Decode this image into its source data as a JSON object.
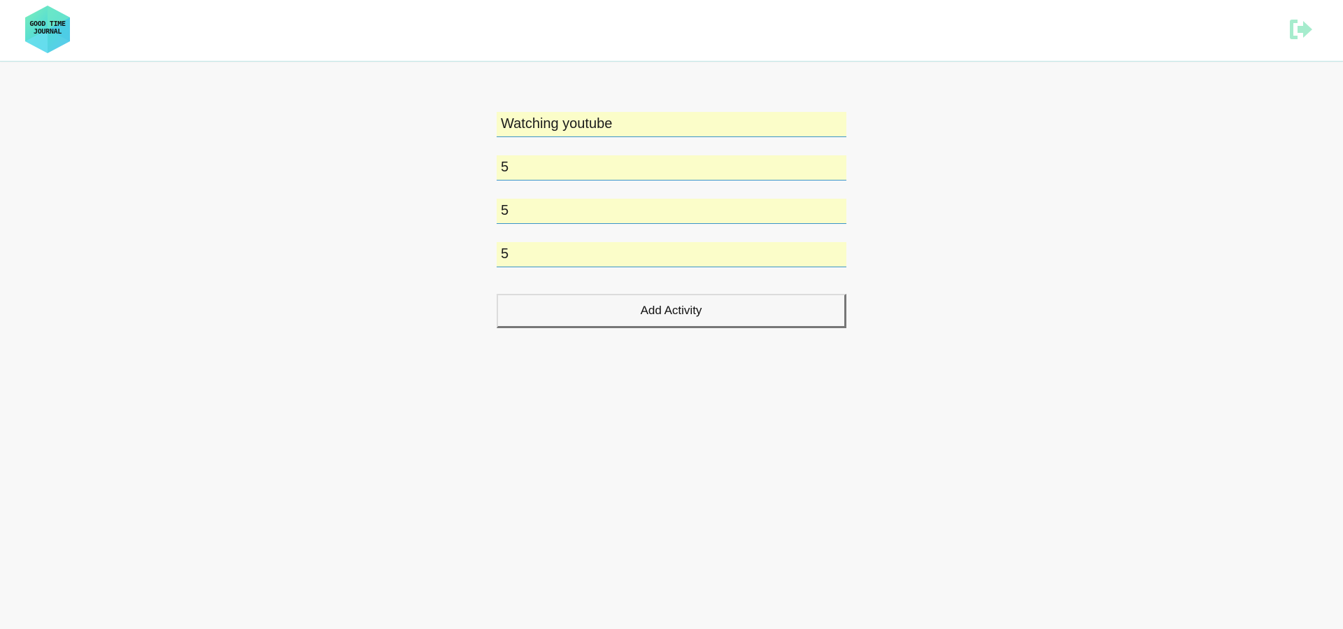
{
  "header": {
    "logo_text": "GOOD TIME\nJOURNAL",
    "logo_colors": [
      "#5fe3c4",
      "#49d6e8",
      "#6ad0f0"
    ],
    "logout_icon": "sign-out-icon",
    "logout_color": "#a6eccd"
  },
  "form": {
    "activity_name": "Watching youtube",
    "field_2": "5",
    "field_3": "5",
    "field_4": "5",
    "field_background": "#fbfdc9",
    "field_underline": "#3a95c9",
    "submit_label": "Add Activity"
  }
}
